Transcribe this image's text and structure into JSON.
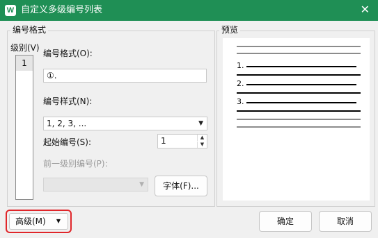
{
  "window": {
    "app_icon_letter": "W",
    "title": "自定义多级编号列表",
    "close_glyph": "✕"
  },
  "numbering_group": {
    "title": "编号格式",
    "level_label": "级别(V)",
    "levels": [
      "1"
    ],
    "format_label": "编号格式(O):",
    "format_value": "①.",
    "style_label": "编号样式(N):",
    "style_value": "1, 2, 3, ...",
    "start_label": "起始编号(S):",
    "start_value": "1",
    "prev_level_label": "前一级别编号(P):",
    "prev_level_value": "",
    "font_button": "字体(F)..."
  },
  "preview": {
    "title": "预览",
    "items": [
      "1.",
      "2.",
      "3."
    ]
  },
  "footer": {
    "advanced_button": "高级(M)",
    "ok_button": "确定",
    "cancel_button": "取消"
  },
  "colors": {
    "titlebar": "#1f8f55",
    "highlight_border": "#e0262a"
  },
  "icons": {
    "app": "wps-writer-icon",
    "close": "close-icon",
    "dropdown": "dropdown-arrow-icon",
    "spin_up": "spin-up-icon",
    "spin_down": "spin-down-icon",
    "expand": "double-chevron-down-icon"
  }
}
